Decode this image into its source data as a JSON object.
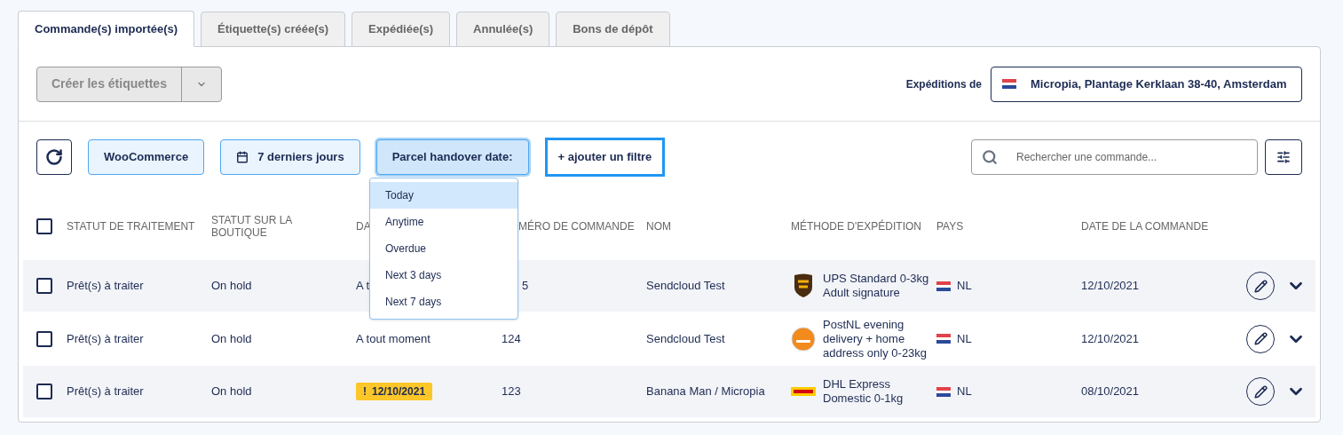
{
  "tabs": [
    {
      "label": "Commande(s) importée(s)",
      "selected": true
    },
    {
      "label": "Étiquette(s) créée(s)",
      "selected": false
    },
    {
      "label": "Expédiée(s)",
      "selected": false
    },
    {
      "label": "Annulée(s)",
      "selected": false
    },
    {
      "label": "Bons de dépôt",
      "selected": false
    }
  ],
  "create_button": {
    "label": "Créer les étiquettes",
    "disabled": true
  },
  "ship_from": {
    "label": "Expéditions de",
    "value": "Micropia, Plantage Kerklaan 38-40, Amsterdam"
  },
  "filters": [
    {
      "label": "WooCommerce",
      "kind": "plain",
      "active": false
    },
    {
      "label": "7 derniers jours",
      "kind": "date",
      "active": false
    },
    {
      "label": "Parcel handover date:",
      "kind": "plain",
      "active": true
    }
  ],
  "add_filter": "+ ajouter un filtre",
  "search": {
    "placeholder": "Rechercher une commande..."
  },
  "dropdown": [
    {
      "label": "Today",
      "selected": true
    },
    {
      "label": "Anytime",
      "selected": false
    },
    {
      "label": "Overdue",
      "selected": false
    },
    {
      "label": "Next 3 days",
      "selected": false
    },
    {
      "label": "Next 7 days",
      "selected": false
    }
  ],
  "table": {
    "select_all_checked": false,
    "columns": [
      "STATUT DE TRAITEMENT",
      "STATUT SUR LA BOUTIQUE",
      "DA",
      "MÉRO DE COMMANDE",
      "NOM",
      "MÉTHODE D'EXPÉDITION",
      "PAYS",
      "DATE DE LA COMMANDE"
    ],
    "rows": [
      {
        "checked": false,
        "status": "Prêt(s) à traiter",
        "shop_status": "On hold",
        "handover": "A t",
        "handover_warning": false,
        "number": "5",
        "name": "Sendcloud Test",
        "logo": {
          "kind": "ups"
        },
        "method": "UPS Standard 0-3kg Adult signature",
        "country": "NL",
        "order_date": "12/10/2021"
      },
      {
        "checked": false,
        "status": "Prêt(s) à traiter",
        "shop_status": "On hold",
        "handover": "A tout moment",
        "handover_warning": false,
        "number": "124",
        "name": "Sendcloud Test",
        "logo": {
          "kind": "postnl"
        },
        "method": "PostNL evening delivery + home address only 0-23kg",
        "country": "NL",
        "order_date": "12/10/2021"
      },
      {
        "checked": false,
        "status": "Prêt(s) à traiter",
        "shop_status": "On hold",
        "handover": "12/10/2021",
        "handover_warning": true,
        "warning_mark": "!",
        "number": "123",
        "name": "Banana Man / Micropia",
        "logo": {
          "kind": "dhl"
        },
        "method": "DHL Express Domestic 0-1kg",
        "country": "NL",
        "order_date": "08/10/2021"
      }
    ]
  }
}
